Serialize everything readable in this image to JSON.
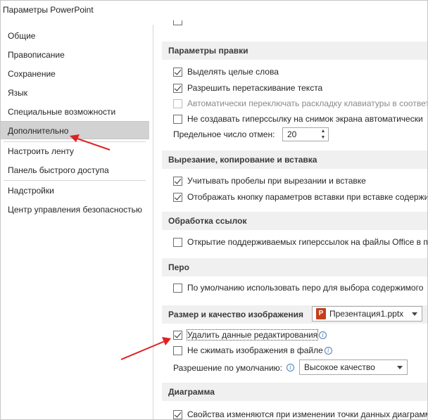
{
  "window": {
    "title": "Параметры PowerPoint"
  },
  "sidebar": {
    "items": [
      {
        "label": "Общие"
      },
      {
        "label": "Правописание"
      },
      {
        "label": "Сохранение"
      },
      {
        "label": "Язык"
      },
      {
        "label": "Специальные возможности"
      },
      {
        "label": "Дополнительно",
        "selected": true
      },
      {
        "label": "Настроить ленту"
      },
      {
        "label": "Панель быстрого доступа"
      },
      {
        "label": "Надстройки"
      },
      {
        "label": "Центр управления безопасностью"
      }
    ]
  },
  "sections": {
    "editing": {
      "title": "Параметры правки",
      "options": [
        {
          "label": "Выделять целые слова",
          "checked": true
        },
        {
          "label": "Разрешить перетаскивание текста",
          "checked": true
        },
        {
          "label": "Автоматически переключать раскладку клавиатуры в соответ",
          "checked": false,
          "disabled": true
        },
        {
          "label": "Не создавать гиперссылку на снимок экрана автоматически",
          "checked": false
        }
      ],
      "undo_label": "Предельное число отмен:",
      "undo_value": "20"
    },
    "cut_copy_paste": {
      "title": "Вырезание, копирование и вставка",
      "options": [
        {
          "label": "Учитывать пробелы при вырезании и вставке",
          "checked": true
        },
        {
          "label": "Отображать кнопку параметров вставки при вставке содержи",
          "checked": true
        }
      ]
    },
    "links": {
      "title": "Обработка ссылок",
      "options": [
        {
          "label": "Открытие поддерживаемых гиперссылок на файлы Office в п",
          "checked": false
        }
      ]
    },
    "pen": {
      "title": "Перо",
      "options": [
        {
          "label": "По умолчанию использовать перо для выбора содержимого",
          "checked": false
        }
      ]
    },
    "image": {
      "title": "Размер и качество изображения",
      "file_combo": "Презентация1.pptx",
      "ppt_icon_letter": "P",
      "options": [
        {
          "label": "Удалить данные редактирования",
          "checked": true
        },
        {
          "label": "Не сжимать изображения в файле",
          "checked": false
        }
      ],
      "resolution_label": "Разрешение по умолчанию:",
      "resolution_value": "Высокое качество"
    },
    "chart": {
      "title": "Диаграмма",
      "options": [
        {
          "label": "Свойства изменяются при изменении точки данных диаграмм",
          "checked": true
        }
      ]
    }
  },
  "icons": {
    "info": "info-icon",
    "spinner_up": "▲",
    "spinner_down": "▼",
    "info_glyph": "i"
  },
  "colors": {
    "annotation_arrow": "#e02020",
    "selected_nav": "#d2d2d2",
    "section_header": "#f0f0f0"
  }
}
